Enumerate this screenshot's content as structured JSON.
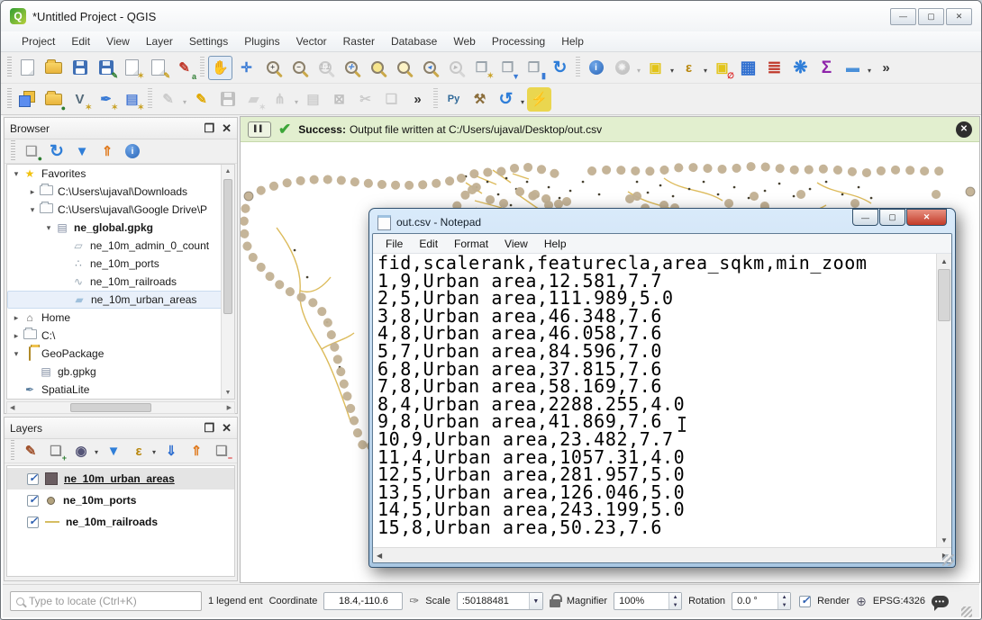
{
  "app": {
    "title": "*Untitled Project - QGIS",
    "window_controls": {
      "minimize": "—",
      "maximize": "▢",
      "close": "✕"
    }
  },
  "menu_bar": {
    "items": [
      "Project",
      "Edit",
      "View",
      "Layer",
      "Settings",
      "Plugins",
      "Vector",
      "Raster",
      "Database",
      "Web",
      "Processing",
      "Help"
    ]
  },
  "toolbars": {
    "row1": [
      {
        "name": "new-project",
        "kind": "page"
      },
      {
        "name": "open-project",
        "kind": "folder"
      },
      {
        "name": "save-project",
        "kind": "disk"
      },
      {
        "name": "save-project-as",
        "kind": "disk",
        "badge": "✎",
        "badgeColor": "#2e7d32"
      },
      {
        "name": "new-print-layout",
        "kind": "page",
        "badge": "✶",
        "badgeColor": "#c9a227"
      },
      {
        "name": "show-layout-manager",
        "kind": "page",
        "badge": "✎",
        "badgeColor": "#c9a227"
      },
      {
        "name": "style-manager",
        "kind": "glyph",
        "glyph": "✎",
        "color": "#c0392b",
        "badge": "a",
        "badgeColor": "#2e7d32"
      },
      {
        "sep": true
      },
      {
        "name": "pan-map",
        "kind": "glyph",
        "glyph": "✋",
        "color": "#b89a7a",
        "pressed": true
      },
      {
        "name": "pan-to-selection",
        "kind": "glyph",
        "glyph": "✛",
        "color": "#3a7bd5"
      },
      {
        "name": "zoom-in",
        "kind": "mag",
        "mag": "+"
      },
      {
        "name": "zoom-out",
        "kind": "mag",
        "mag": "−"
      },
      {
        "name": "zoom-native",
        "kind": "mag",
        "mag": "1:1",
        "disabled": true
      },
      {
        "name": "zoom-full",
        "kind": "mag",
        "mag": "✛",
        "magColor": "#3a7bd5"
      },
      {
        "name": "zoom-to-selection",
        "kind": "mag",
        "bg": "#f6e58d"
      },
      {
        "name": "zoom-to-layer",
        "kind": "mag",
        "bg": "#fdf3c6"
      },
      {
        "name": "zoom-last",
        "kind": "mag",
        "mag": "◂",
        "magColor": "#3a7bd5"
      },
      {
        "name": "zoom-next",
        "kind": "mag",
        "mag": "▸",
        "disabled": true
      },
      {
        "name": "new-bookmark",
        "kind": "glyph",
        "glyph": "❒",
        "color": "#9aa4ac",
        "badge": "✶",
        "badgeColor": "#c9a227"
      },
      {
        "name": "show-bookmarks",
        "kind": "glyph",
        "glyph": "❒",
        "color": "#9aa4ac",
        "badge": "▼",
        "badgeColor": "#3a7bd5"
      },
      {
        "name": "bookmark-manager",
        "kind": "glyph",
        "glyph": "❒",
        "color": "#9aa4ac",
        "badge": "▮",
        "badgeColor": "#3a7bd5"
      },
      {
        "name": "refresh-map",
        "kind": "glyph",
        "glyph": "↻",
        "color": "#2f7ed8",
        "big": true
      },
      {
        "sep": true
      },
      {
        "name": "identify-features",
        "kind": "round",
        "glyph": "i"
      },
      {
        "name": "run-feature-action",
        "kind": "round",
        "glyph": "❋",
        "disabled": true,
        "dropdown": true
      },
      {
        "name": "select-features",
        "kind": "glyph",
        "glyph": "▣",
        "color": "#e2c419",
        "dropdown": true
      },
      {
        "name": "select-by-expression",
        "kind": "glyph",
        "glyph": "ε",
        "color": "#b8860b",
        "dropdown": true
      },
      {
        "name": "deselect-features",
        "kind": "glyph",
        "glyph": "▣",
        "color": "#e2c419",
        "badge": "∅",
        "badgeColor": "#d22"
      },
      {
        "name": "open-attribute-table",
        "kind": "glyph",
        "glyph": "▦",
        "color": "#2f6fd0",
        "big": true
      },
      {
        "name": "field-calculator",
        "kind": "glyph",
        "glyph": "≣",
        "color": "#c0392b",
        "big": true
      },
      {
        "name": "processing-toolbox",
        "kind": "glyph",
        "glyph": "❋",
        "color": "#2f7ed8",
        "big": true
      },
      {
        "name": "show-statistical-summary",
        "kind": "glyph",
        "glyph": "Σ",
        "color": "#8e24aa",
        "big": true
      },
      {
        "name": "measure-line",
        "kind": "glyph",
        "glyph": "▬",
        "color": "#4a90d9",
        "dropdown": true
      },
      {
        "name": "toolbar-overflow",
        "kind": "glyph",
        "glyph": "»",
        "color": "#333"
      }
    ],
    "row2": [
      {
        "name": "data-source-manager",
        "kind": "layers"
      },
      {
        "name": "new-geopackage-layer",
        "kind": "folder",
        "badge": "●",
        "badgeColor": "#2e7d32"
      },
      {
        "name": "new-shapefile-layer",
        "kind": "glyph",
        "glyph": "V",
        "color": "#546a7a",
        "badge": "✶",
        "badgeColor": "#c9a227"
      },
      {
        "name": "new-spatialite-layer",
        "kind": "glyph",
        "glyph": "✒",
        "color": "#3a7bd5",
        "badge": "✶",
        "badgeColor": "#c9a227"
      },
      {
        "name": "new-virtual-layer",
        "kind": "glyph",
        "glyph": "▤",
        "color": "#4a7bd5",
        "badge": "✶",
        "badgeColor": "#c9a227"
      },
      {
        "sep": true
      },
      {
        "name": "current-edits",
        "kind": "glyph",
        "glyph": "✎",
        "color": "#888",
        "disabled": true,
        "dropdown": true
      },
      {
        "name": "toggle-editing",
        "kind": "glyph",
        "glyph": "✎",
        "color": "#e0a800"
      },
      {
        "name": "save-layer-edits",
        "kind": "disk",
        "disabled": true
      },
      {
        "name": "add-feature",
        "kind": "glyph",
        "glyph": "▰",
        "color": "#999",
        "disabled": true,
        "badge": "✶"
      },
      {
        "name": "vertex-tool",
        "kind": "glyph",
        "glyph": "⋔",
        "color": "#888",
        "disabled": true,
        "dropdown": true
      },
      {
        "name": "modify-attributes",
        "kind": "glyph",
        "glyph": "▤",
        "color": "#888",
        "disabled": true
      },
      {
        "name": "delete-selected",
        "kind": "glyph",
        "glyph": "⊠",
        "color": "#a55",
        "disabled": true
      },
      {
        "name": "cut-features",
        "kind": "glyph",
        "glyph": "✂",
        "color": "#888",
        "disabled": true
      },
      {
        "name": "copy-features",
        "kind": "glyph",
        "glyph": "❏",
        "color": "#888",
        "disabled": true
      },
      {
        "name": "toolbar-overflow-2",
        "kind": "glyph",
        "glyph": "»",
        "color": "#333"
      },
      {
        "sep": true
      },
      {
        "name": "python-console",
        "kind": "glyph",
        "glyph": "Py",
        "color": "#306998",
        "small": true
      },
      {
        "name": "osgeo-build-tools",
        "kind": "glyph",
        "glyph": "⚒",
        "color": "#8a6d3b"
      },
      {
        "name": "redo-action",
        "kind": "glyph",
        "glyph": "↺",
        "color": "#2f7ed8",
        "big": true,
        "dropdown": true
      },
      {
        "name": "plugin-tool",
        "kind": "glyph",
        "glyph": "⚡",
        "color": "#2a8a2a",
        "bg": "#ead64f"
      }
    ]
  },
  "message_bar": {
    "pause_icon": "▌▌",
    "status_label": "Success:",
    "message": "Output file written at C:/Users/ujaval/Desktop/out.csv",
    "close_icon": "✕"
  },
  "browser_panel": {
    "title": "Browser",
    "toolbar": [
      {
        "name": "browser-add-layer",
        "kind": "glyph",
        "glyph": "❏",
        "color": "#999",
        "badge": "●",
        "badgeColor": "#2e7d32"
      },
      {
        "name": "browser-refresh",
        "kind": "glyph",
        "glyph": "↻",
        "color": "#2f7ed8",
        "big": true
      },
      {
        "name": "browser-filter",
        "kind": "glyph",
        "glyph": "▼",
        "color": "#2f7ed8"
      },
      {
        "name": "browser-collapse-all",
        "kind": "glyph",
        "glyph": "⇑",
        "color": "#e07b20"
      },
      {
        "name": "browser-properties",
        "kind": "round",
        "glyph": "i"
      }
    ],
    "tree": [
      {
        "depth": 0,
        "exp": "open",
        "icon": "star",
        "label": "Favorites"
      },
      {
        "depth": 1,
        "exp": "closed",
        "icon": "folder",
        "label": "C:\\Users\\ujaval\\Downloads"
      },
      {
        "depth": 1,
        "exp": "open",
        "icon": "folder",
        "label": "C:\\Users\\ujaval\\Google Drive\\P"
      },
      {
        "depth": 2,
        "exp": "open",
        "icon": "db",
        "label": "ne_global.gpkg",
        "bold": true
      },
      {
        "depth": 3,
        "exp": "",
        "icon": "polygon",
        "label": "ne_10m_admin_0_count"
      },
      {
        "depth": 3,
        "exp": "",
        "icon": "points",
        "label": "ne_10m_ports"
      },
      {
        "depth": 3,
        "exp": "",
        "icon": "line",
        "label": "ne_10m_railroads"
      },
      {
        "depth": 3,
        "exp": "",
        "icon": "blob",
        "label": "ne_10m_urban_areas",
        "selected": true
      },
      {
        "depth": 0,
        "exp": "closed",
        "icon": "home",
        "label": "Home"
      },
      {
        "depth": 0,
        "exp": "closed",
        "icon": "folder",
        "label": "C:\\"
      },
      {
        "depth": 0,
        "exp": "open",
        "icon": "gpkg",
        "label": "GeoPackage"
      },
      {
        "depth": 1,
        "exp": "",
        "icon": "db",
        "label": "gb.gpkg"
      },
      {
        "depth": 0,
        "exp": "",
        "icon": "spatialite",
        "label": "SpatiaLite"
      }
    ]
  },
  "layers_panel": {
    "title": "Layers",
    "toolbar": [
      {
        "name": "layer-styling",
        "kind": "glyph",
        "glyph": "✎",
        "color": "#a0522d"
      },
      {
        "name": "add-group",
        "kind": "glyph",
        "glyph": "❏",
        "color": "#888",
        "badge": "+",
        "badgeColor": "#2e7d32"
      },
      {
        "name": "manage-visibility",
        "kind": "glyph",
        "glyph": "◉",
        "color": "#557",
        "dropdown": true
      },
      {
        "name": "filter-legend",
        "kind": "glyph",
        "glyph": "▼",
        "color": "#2f7ed8"
      },
      {
        "name": "filter-expression",
        "kind": "glyph",
        "glyph": "ε",
        "color": "#b8860b",
        "dropdown": true
      },
      {
        "name": "expand-all",
        "kind": "glyph",
        "glyph": "⇓",
        "color": "#2f6fd0"
      },
      {
        "name": "collapse-all",
        "kind": "glyph",
        "glyph": "⇑",
        "color": "#e07b20"
      },
      {
        "name": "remove-layer",
        "kind": "glyph",
        "glyph": "❏",
        "color": "#888",
        "badge": "−",
        "badgeColor": "#d22"
      }
    ],
    "layers": [
      {
        "checked": true,
        "swatch": "fill",
        "label": "ne_10m_urban_areas",
        "selected": true
      },
      {
        "checked": true,
        "swatch": "point",
        "label": "ne_10m_ports"
      },
      {
        "checked": true,
        "swatch": "line",
        "label": "ne_10m_railroads"
      }
    ]
  },
  "notepad": {
    "title": "out.csv - Notepad",
    "menus": [
      "File",
      "Edit",
      "Format",
      "View",
      "Help"
    ],
    "window_controls": {
      "minimize": "—",
      "maximize": "▢",
      "close": "✕"
    },
    "lines": [
      "fid,scalerank,featurecla,area_sqkm,min_zoom",
      "1,9,Urban area,12.581,7.7",
      "2,5,Urban area,111.989,5.0",
      "3,8,Urban area,46.348,7.6",
      "4,8,Urban area,46.058,7.6",
      "5,7,Urban area,84.596,7.0",
      "6,8,Urban area,37.815,7.6",
      "7,8,Urban area,58.169,7.6",
      "8,4,Urban area,2288.255,4.0",
      "9,8,Urban area,41.869,7.6",
      "10,9,Urban area,23.482,7.7",
      "11,4,Urban area,1057.31,4.0",
      "12,5,Urban area,281.957,5.0",
      "13,5,Urban area,126.046,5.0",
      "14,5,Urban area,243.199,5.0",
      "15,8,Urban area,50.23,7.6"
    ]
  },
  "status_bar": {
    "locate_placeholder": "Type to locate (Ctrl+K)",
    "legend_text": "1 legend ent",
    "coordinate_label": "Coordinate",
    "coordinate_value": "18.4,-110.6",
    "scale_label": "Scale",
    "scale_value": ":50188481",
    "magnifier_label": "Magnifier",
    "magnifier_value": "100%",
    "rotation_label": "Rotation",
    "rotation_value": "0.0 °",
    "render_label": "Render",
    "epsg_text": "EPSG:4326",
    "bubble_dots": "•••"
  },
  "colors": {
    "success_bg": "#e2efcf",
    "port_fill": "#c2b193",
    "port_stroke": "#5f574a",
    "railroad": "#d9b44a",
    "urban": "#46402f"
  }
}
